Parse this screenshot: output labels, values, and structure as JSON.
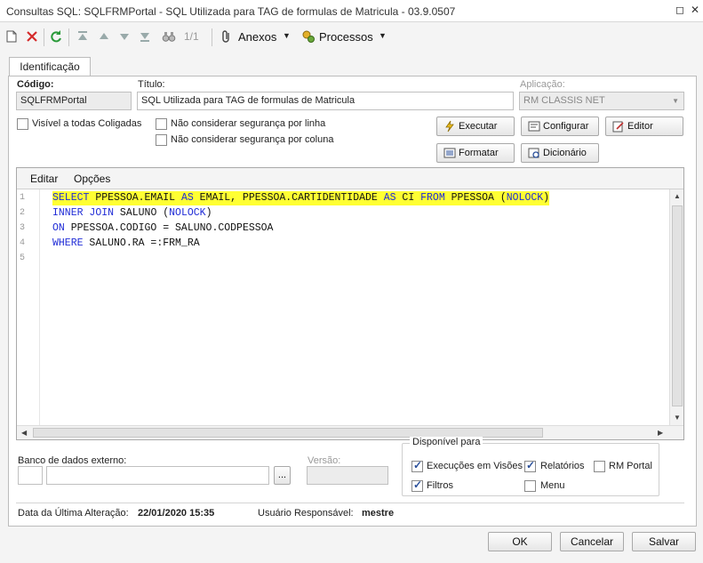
{
  "window": {
    "title": "Consultas SQL: SQLFRMPortal - SQL Utilizada para TAG de formulas de Matricula - 03.9.0507",
    "restore_glyph": "◻",
    "close_glyph": "✕"
  },
  "toolbar": {
    "pager": "1/1",
    "anexos_label": "Anexos",
    "processos_label": "Processos",
    "icons": [
      "new-doc-icon",
      "delete-icon",
      "refresh-icon",
      "first-icon",
      "prev-icon",
      "next-icon",
      "last-icon",
      "binoculars-icon",
      "paperclip-icon",
      "processos-icon"
    ]
  },
  "tabs": [
    {
      "label": "Identificação"
    }
  ],
  "form": {
    "codigo_label": "Código:",
    "codigo_value": "SQLFRMPortal",
    "titulo_label": "Título:",
    "titulo_value": "SQL Utilizada para TAG de formulas de Matricula",
    "aplicacao_label": "Aplicação:",
    "aplicacao_value": "RM CLASSIS NET",
    "visivel_label": "Visível a todas Coligadas",
    "seg_linha_label": "Não considerar segurança por linha",
    "seg_coluna_label": "Não considerar segurança por coluna"
  },
  "buttons": {
    "executar": "Executar",
    "configurar": "Configurar",
    "editor": "Editor",
    "formatar": "Formatar",
    "dicionario": "Dicionário"
  },
  "editor": {
    "menu": [
      "Editar",
      "Opções"
    ],
    "line_numbers": [
      "1",
      "2",
      "3",
      "4",
      "5"
    ],
    "lines": [
      "SELECT PPESSOA.EMAIL AS EMAIL, PPESSOA.CARTIDENTIDADE AS CI FROM PPESSOA (NOLOCK)",
      "INNER JOIN SALUNO (NOLOCK)",
      "ON PPESSOA.CODIGO = SALUNO.CODPESSOA",
      "WHERE SALUNO.RA =:FRM_RA",
      ""
    ],
    "highlighted_line": 1
  },
  "banco": {
    "label": "Banco de dados externo:",
    "browse": "...",
    "versao_label": "Versão:"
  },
  "disponivel": {
    "title": "Disponível para",
    "execucoes": "Execuções em Visões",
    "relatorios": "Relatórios",
    "rm_portal": "RM Portal",
    "filtros": "Filtros",
    "menu": "Menu"
  },
  "footer": {
    "data_label": "Data da Última Alteração:",
    "data_value": "22/01/2020 15:35",
    "usuario_label": "Usuário Responsável:",
    "usuario_value": "mestre"
  },
  "actions": {
    "ok": "OK",
    "cancelar": "Cancelar",
    "salvar": "Salvar"
  },
  "colors": {
    "highlight": "#ffff33",
    "keyword": "#1f2bd6"
  }
}
